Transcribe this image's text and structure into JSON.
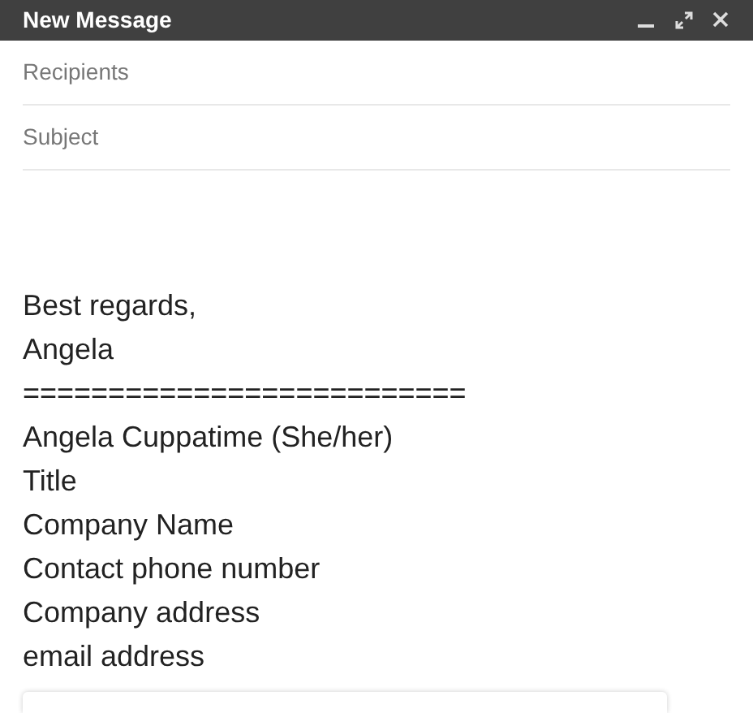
{
  "window": {
    "title": "New Message"
  },
  "fields": [
    {
      "placeholder": "Recipients"
    },
    {
      "placeholder": "Subject"
    }
  ],
  "body": {
    "lines": [
      "Best regards,",
      "Angela",
      "==========================",
      "Angela Cuppatime (She/her)",
      "Title",
      "Company Name",
      "Contact phone number",
      "Company address",
      "email address"
    ]
  }
}
